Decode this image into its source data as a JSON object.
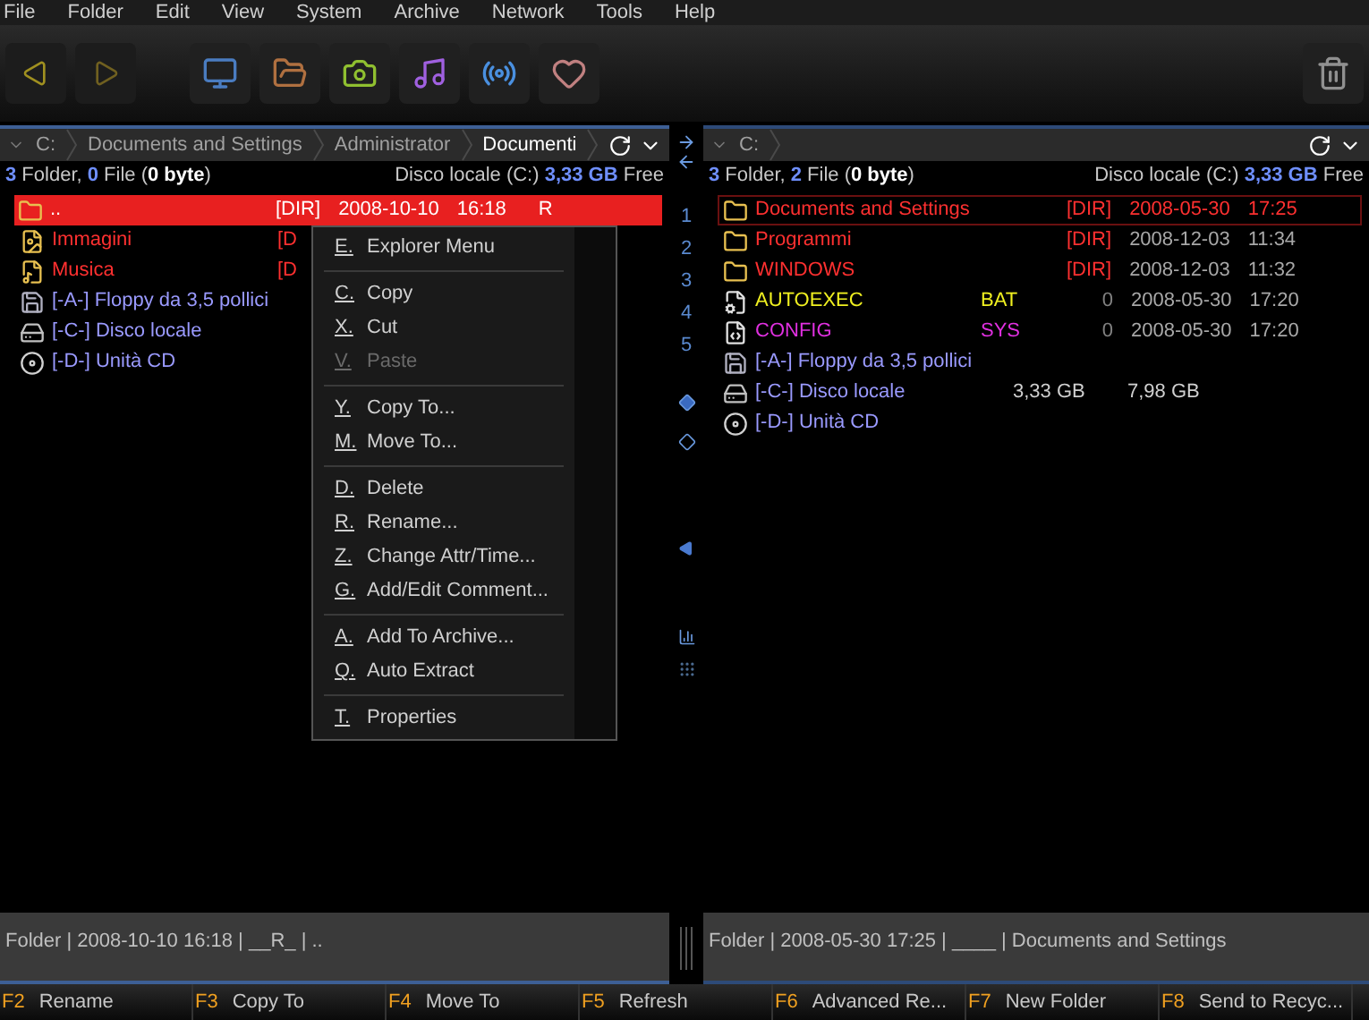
{
  "menu_bar": [
    {
      "label": "File"
    },
    {
      "label": "Folder"
    },
    {
      "label": "Edit"
    },
    {
      "label": "View"
    },
    {
      "label": "System"
    },
    {
      "label": "Archive"
    },
    {
      "label": "Network"
    },
    {
      "label": "Tools"
    },
    {
      "label": "Help"
    }
  ],
  "left_panel": {
    "active": true,
    "breadcrumb": [
      "C:",
      "Documents and Settings",
      "Administrator",
      "Documenti"
    ],
    "summary": [
      {
        "text": "3",
        "kind": "count"
      },
      {
        "text": " Folder, ",
        "kind": "plain"
      },
      {
        "text": "0",
        "kind": "count"
      },
      {
        "text": " File (",
        "kind": "plain"
      },
      {
        "text": "0 byte",
        "kind": "strong"
      },
      {
        "text": ")",
        "kind": "plain"
      }
    ],
    "drive_info": [
      {
        "text": "Disco locale (C:) ",
        "kind": "plain"
      },
      {
        "text": "3,33 GB",
        "kind": "count"
      },
      {
        "text": " Free",
        "kind": "plain"
      }
    ],
    "rows": [
      {
        "kind": "folder",
        "name": "..",
        "color": "#ffffff",
        "col_2": "[DIR]",
        "col_3": "2008-10-10",
        "col_4": "16:18",
        "col_5": "R",
        "selected": true
      },
      {
        "kind": "pictures",
        "name": "Immagini",
        "color": "#ff3030",
        "col_2": "[D",
        "selected": false
      },
      {
        "kind": "music",
        "name": "Musica",
        "color": "#ff3030",
        "col_2": "[D",
        "selected": false
      },
      {
        "kind": "floppy",
        "name": "[-A-] Floppy da 3,5 pollici",
        "color": "#9a9aff",
        "selected": false
      },
      {
        "kind": "disk",
        "name": "[-C-] Disco locale",
        "color": "#9a9aff",
        "selected": false
      },
      {
        "kind": "cd",
        "name": "[-D-] Unità CD",
        "color": "#9a9aff",
        "selected": false
      }
    ],
    "status": "Folder | 2008-10-10 16:18 | __R_ | .."
  },
  "right_panel": {
    "active": false,
    "breadcrumb": [
      "C:"
    ],
    "summary": [
      {
        "text": "3",
        "kind": "count"
      },
      {
        "text": " Folder, ",
        "kind": "plain"
      },
      {
        "text": "2",
        "kind": "count"
      },
      {
        "text": " File (",
        "kind": "plain"
      },
      {
        "text": "0 byte",
        "kind": "strong"
      },
      {
        "text": ")",
        "kind": "plain"
      }
    ],
    "drive_info": [
      {
        "text": "Disco locale (C:) ",
        "kind": "plain"
      },
      {
        "text": "3,33 GB",
        "kind": "count"
      },
      {
        "text": " Free",
        "kind": "plain"
      }
    ],
    "rows": [
      {
        "kind": "folder",
        "name": "Documents and Settings",
        "color": "#ff3030",
        "col_2": "[DIR]",
        "col_3": "2008-05-30",
        "col_4": "17:25",
        "selected": true
      },
      {
        "kind": "folder",
        "name": "Programmi",
        "color": "#ff3030",
        "col_2": "[DIR]",
        "col_3": "2008-12-03",
        "col_4": "11:34",
        "selected": false
      },
      {
        "kind": "folder",
        "name": "WINDOWS",
        "color": "#ff3030",
        "col_2": "[DIR]",
        "col_3": "2008-12-03",
        "col_4": "11:32",
        "selected": false
      },
      {
        "kind": "batch",
        "name": "AUTOEXEC",
        "ext": "BAT",
        "color": "#f0f020",
        "col_2": "0",
        "col_3": "2008-05-30",
        "col_4": "17:20",
        "selected": false
      },
      {
        "kind": "config",
        "name": "CONFIG",
        "ext": "SYS",
        "color": "#e030e0",
        "col_2": "0",
        "col_3": "2008-05-30",
        "col_4": "17:20",
        "selected": false
      },
      {
        "kind": "floppy",
        "name": "[-A-] Floppy da 3,5 pollici",
        "color": "#9a9aff",
        "selected": false
      },
      {
        "kind": "disk",
        "name": "[-C-] Disco locale",
        "color": "#9a9aff",
        "free": "3,33 GB",
        "total": "7,98 GB",
        "selected": false
      },
      {
        "kind": "cd",
        "name": "[-D-] Unità CD",
        "color": "#9a9aff",
        "selected": false
      }
    ],
    "status": "Folder | 2008-05-30 17:25 | ____ | Documents and Settings"
  },
  "middle_strip": {
    "tabs": [
      "1",
      "2",
      "3",
      "4",
      "5"
    ]
  },
  "context_menu": [
    [
      {
        "key": "E.",
        "label": "Explorer Menu",
        "disabled": false
      }
    ],
    [
      {
        "key": "C.",
        "label": "Copy",
        "disabled": false
      },
      {
        "key": "X.",
        "label": "Cut",
        "disabled": false
      },
      {
        "key": "V.",
        "label": "Paste",
        "disabled": true
      }
    ],
    [
      {
        "key": "Y.",
        "label": "Copy To...",
        "disabled": false
      },
      {
        "key": "M.",
        "label": "Move To...",
        "disabled": false
      }
    ],
    [
      {
        "key": "D.",
        "label": "Delete",
        "disabled": false
      },
      {
        "key": "R.",
        "label": "Rename...",
        "disabled": false
      },
      {
        "key": "Z.",
        "label": "Change Attr/Time...",
        "disabled": false
      },
      {
        "key": "G.",
        "label": "Add/Edit Comment...",
        "disabled": false
      }
    ],
    [
      {
        "key": "A.",
        "label": "Add To Archive...",
        "disabled": false
      },
      {
        "key": "Q.",
        "label": "Auto Extract",
        "disabled": false
      }
    ],
    [
      {
        "key": "T.",
        "label": "Properties",
        "disabled": false
      }
    ]
  ],
  "function_keys": [
    {
      "key": "F2",
      "label": "Rename"
    },
    {
      "key": "F3",
      "label": "Copy To"
    },
    {
      "key": "F4",
      "label": "Move To"
    },
    {
      "key": "F5",
      "label": "Refresh"
    },
    {
      "key": "F6",
      "label": "Advanced Re..."
    },
    {
      "key": "F7",
      "label": "New Folder"
    },
    {
      "key": "F8",
      "label": "Send to Recyc..."
    }
  ]
}
